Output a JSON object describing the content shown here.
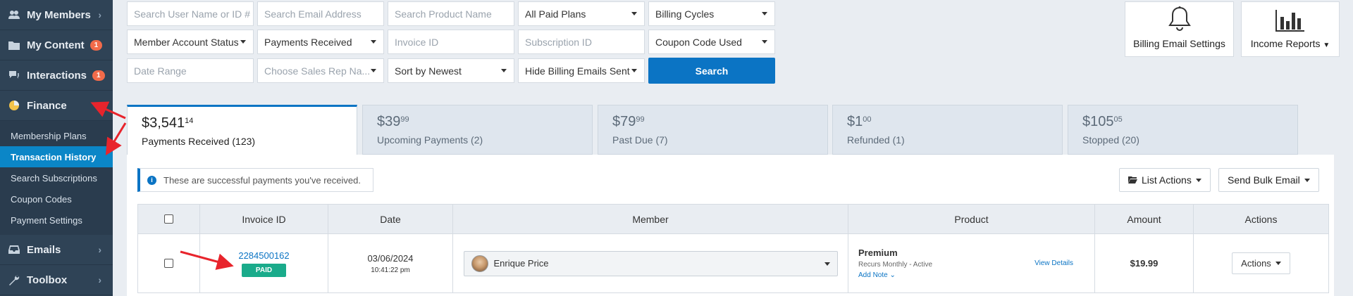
{
  "sidebar": {
    "items": [
      {
        "label": "My Members",
        "icon": "users-icon",
        "badge": ""
      },
      {
        "label": "My Content",
        "icon": "folder-icon",
        "badge": "1"
      },
      {
        "label": "Interactions",
        "icon": "chat-icon",
        "badge": "1"
      },
      {
        "label": "Finance",
        "icon": "pie-chart-icon",
        "badge": ""
      }
    ],
    "finance_sub": [
      "Membership Plans",
      "Transaction History",
      "Search Subscriptions",
      "Coupon Codes",
      "Payment Settings"
    ],
    "bottom_items": [
      {
        "label": "Emails",
        "icon": "inbox-icon"
      },
      {
        "label": "Toolbox",
        "icon": "wrench-icon"
      }
    ]
  },
  "filters": {
    "search_user_placeholder": "Search User Name or ID #",
    "search_email_placeholder": "Search Email Address",
    "search_product_placeholder": "Search Product Name",
    "plans_select": "All Paid Plans",
    "billing_cycles_select": "Billing Cycles",
    "account_status_select": "Member Account Status",
    "payments_select": "Payments Received",
    "invoice_placeholder": "Invoice ID",
    "subscription_placeholder": "Subscription ID",
    "coupon_select": "Coupon Code Used",
    "date_range_placeholder": "Date Range",
    "sales_rep_select": "Choose Sales Rep Na...",
    "sort_select": "Sort by Newest",
    "hide_emails_select": "Hide Billing Emails Sent",
    "search_button": "Search"
  },
  "tools": {
    "billing_email": "Billing Email Settings",
    "income_reports": "Income Reports"
  },
  "tabs": [
    {
      "dollars": "$3,541",
      "cents": "14",
      "label": "Payments Received (123)"
    },
    {
      "dollars": "$39",
      "cents": "99",
      "label": "Upcoming Payments (2)"
    },
    {
      "dollars": "$79",
      "cents": "99",
      "label": "Past Due (7)"
    },
    {
      "dollars": "$1",
      "cents": "00",
      "label": "Refunded (1)"
    },
    {
      "dollars": "$105",
      "cents": "05",
      "label": "Stopped (20)"
    }
  ],
  "notice": "These are successful payments you've received.",
  "panel_buttons": {
    "list_actions": "List Actions",
    "send_bulk_email": "Send Bulk Email"
  },
  "table": {
    "headers": [
      "Invoice ID",
      "Date",
      "Member",
      "Product",
      "Amount",
      "Actions"
    ],
    "rows": [
      {
        "invoice_id": "2284500162",
        "status": "PAID",
        "date": "03/06/2024",
        "time": "10:41:22 pm",
        "member": "Enrique Price",
        "product": "Premium",
        "product_sub": "Recurs Monthly - Active",
        "view_details": "View Details",
        "add_note": "Add Note",
        "amount": "$19.99",
        "actions": "Actions"
      }
    ]
  },
  "colors": {
    "sidebar_bg": "#2f4356",
    "accent": "#0b74c4",
    "paid_badge": "#1aab8b",
    "notification_badge": "#f26b4a",
    "annotation_arrow": "#e8242c"
  }
}
